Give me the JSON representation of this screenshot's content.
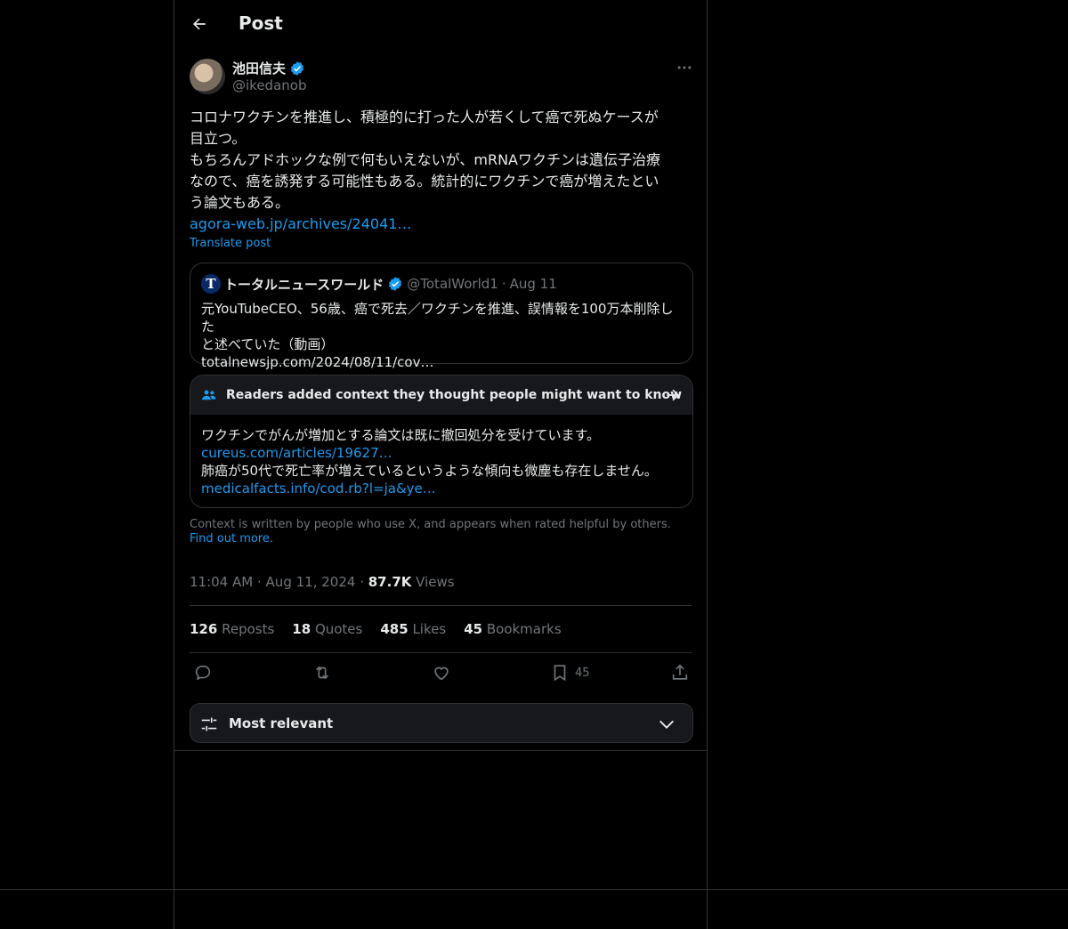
{
  "header": {
    "title": "Post"
  },
  "author": {
    "name": "池田信夫",
    "handle": "@ikedanob"
  },
  "tweet": {
    "lines": [
      "コロナワクチンを推進し、積極的に打った人が若くして癌で死ぬケースが",
      "目立つ。",
      "もちろんアドホックな例で何もいえないが、mRNAワクチンは遺伝子治療",
      "なので、癌を誘発する可能性もある。統計的にワクチンで癌が増えたとい",
      "う論文もある。"
    ],
    "link": "agora-web.jp/archives/24041…",
    "translate": "Translate post"
  },
  "quote": {
    "avatar_letter": "T",
    "name": "トータルニュースワールド",
    "handle": "@TotalWorld1",
    "sep": "·",
    "date": "Aug 11",
    "lines": [
      "元YouTubeCEO、56歳、癌で死去／ワクチンを推進、誤情報を100万本削除した",
      "と述べていた（動画）",
      "totalnewsjp.com/2024/08/11/cov…"
    ]
  },
  "note": {
    "title": "Readers added context they thought people might want to know",
    "body": [
      {
        "text": "ワクチンでがんが増加とする論文は既に撤回処分を受けています。",
        "link": false
      },
      {
        "text": "cureus.com/articles/19627…",
        "link": true
      },
      {
        "text": "肺癌が50代で死亡率が増えているというような傾向も微塵も存在しません。",
        "link": false
      },
      {
        "text": "medicalfacts.info/cod.rb?l=ja&ye…",
        "link": true
      }
    ],
    "footer": "Context is written by people who use X, and appears when rated helpful by others.",
    "footer_link": "Find out more."
  },
  "meta": {
    "time": "11:04 AM",
    "date": "Aug 11, 2024",
    "sep": "·",
    "views": "87.7K",
    "views_label": "Views"
  },
  "stats": [
    {
      "count": "126",
      "label": "Reposts"
    },
    {
      "count": "18",
      "label": "Quotes"
    },
    {
      "count": "485",
      "label": "Likes"
    },
    {
      "count": "45",
      "label": "Bookmarks"
    }
  ],
  "actions": {
    "bookmark_count": "45"
  },
  "sort": {
    "label": "Most relevant"
  },
  "colors": {
    "accent": "#1d9bf0",
    "muted": "#71767b",
    "border": "#2f3336",
    "text": "#e7e9ea"
  }
}
